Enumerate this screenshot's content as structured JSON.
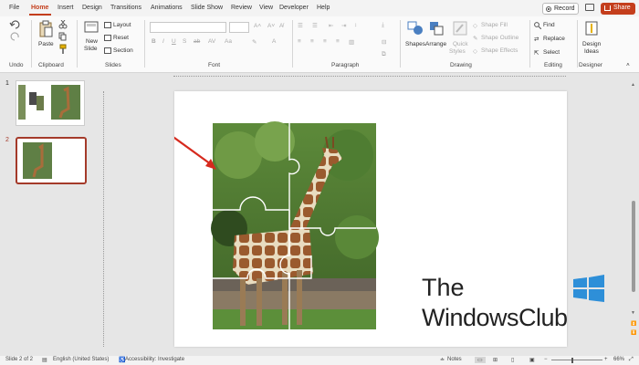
{
  "tabs": [
    "File",
    "Home",
    "Insert",
    "Design",
    "Transitions",
    "Animations",
    "Slide Show",
    "Review",
    "View",
    "Developer",
    "Help"
  ],
  "active_tab": "Home",
  "record_label": "Record",
  "share_label": "Share",
  "ribbon": {
    "undo_group": "Undo",
    "clipboard_group": "Clipboard",
    "paste_label": "Paste",
    "slides_group": "Slides",
    "new_slide_label": "New",
    "new_slide_label2": "Slide",
    "layout_label": "Layout",
    "reset_label": "Reset",
    "section_label": "Section",
    "font_group": "Font",
    "paragraph_group": "Paragraph",
    "drawing_group": "Drawing",
    "shapes_label": "Shapes",
    "arrange_label": "Arrange",
    "quick_styles_label": "Quick",
    "quick_styles_label2": "Styles",
    "shape_fill_label": "Shape Fill",
    "shape_outline_label": "Shape Outline",
    "shape_effects_label": "Shape Effects",
    "editing_group": "Editing",
    "find_label": "Find",
    "replace_label": "Replace",
    "select_label": "Select",
    "designer_group": "Designer",
    "design_ideas_label": "Design",
    "design_ideas_label2": "Ideas"
  },
  "slides": [
    {
      "number": "1"
    },
    {
      "number": "2"
    }
  ],
  "status": {
    "slide_count": "Slide 2 of 2",
    "language": "English (United States)",
    "accessibility": "Accessibility: Investigate",
    "notes": "Notes",
    "zoom": "66%"
  },
  "watermark": {
    "line1": "The",
    "line2": "WindowsClub"
  },
  "colors": {
    "accent": "#c43e1c",
    "arrow": "#d62a1e",
    "selection": "#a43a2a"
  }
}
